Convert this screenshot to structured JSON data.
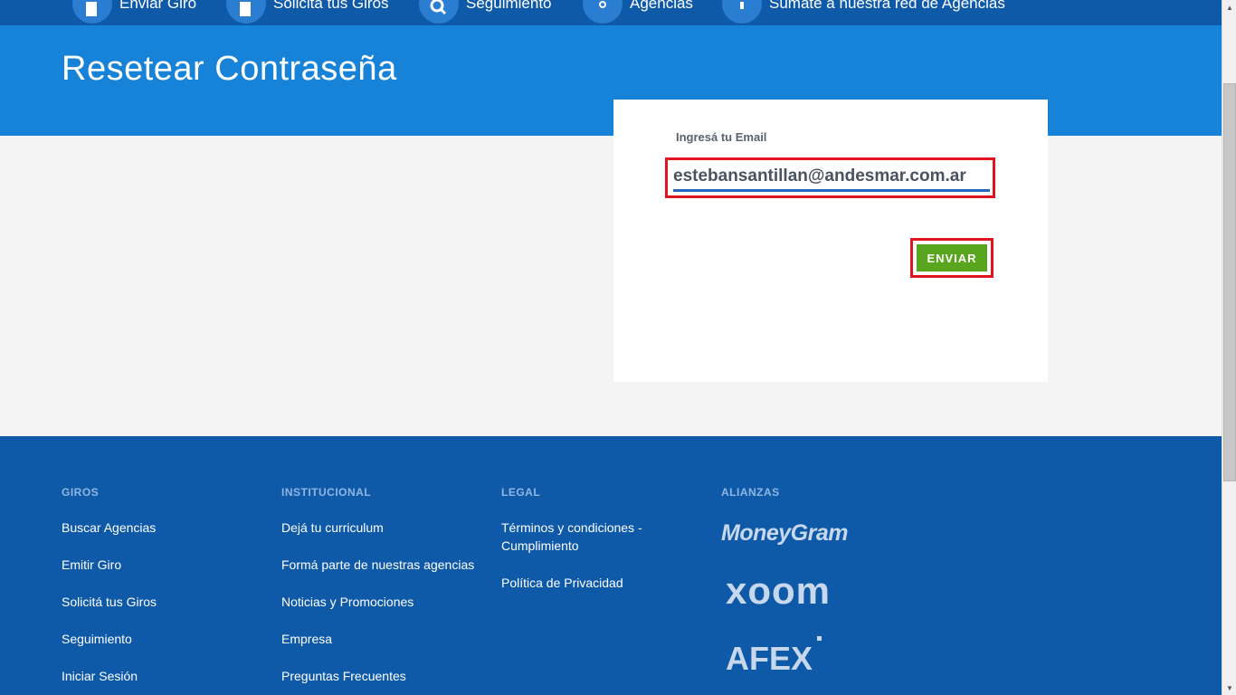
{
  "nav": {
    "items": [
      {
        "label": "Enviar Giro",
        "icon": "doc-pen-icon"
      },
      {
        "label": "Solicita tus Giros",
        "icon": "doc-pen-icon"
      },
      {
        "label": "Seguimiento",
        "icon": "search-icon"
      },
      {
        "label": "Agencias",
        "icon": "map-pin-icon"
      },
      {
        "label": "Sumate a nuestra red de Agencias",
        "icon": "info-icon"
      }
    ]
  },
  "page": {
    "title": "Resetear Contraseña"
  },
  "form": {
    "email_label": "Ingresá tu Email",
    "email_value": "estebansantillan@andesmar.com.ar",
    "submit_label": "ENVIAR"
  },
  "footer": {
    "giros": {
      "heading": "GIROS",
      "links": [
        "Buscar Agencias",
        "Emitir Giro",
        "Solicitá tus Giros",
        "Seguimiento",
        "Iniciar Sesión"
      ]
    },
    "institucional": {
      "heading": "INSTITUCIONAL",
      "links": [
        "Dejá tu curriculum",
        "Formá parte de nuestras agencias",
        "Noticias y Promociones",
        "Empresa",
        "Preguntas Frecuentes"
      ]
    },
    "legal": {
      "heading": "LEGAL",
      "links": [
        "Términos y condiciones - Cumplimiento",
        "Política de Privacidad"
      ]
    },
    "alianzas": {
      "heading": "ALIANZAS",
      "logos": [
        "MoneyGram",
        "xoom",
        "AFEX"
      ]
    }
  },
  "colors": {
    "nav_bg": "#0f5aa8",
    "hero_bg": "#1682d8",
    "footer_bg": "#0f5aa8",
    "button_green": "#5aa51e",
    "highlight_red": "#e0141e"
  }
}
